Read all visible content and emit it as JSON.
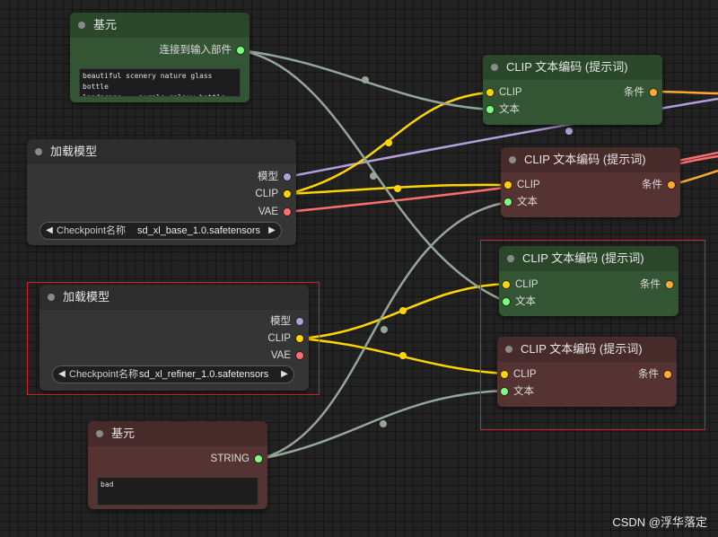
{
  "colors": {
    "background": "#222222",
    "clip_pin": "#ffd500",
    "model_pin": "#b39ddb",
    "vae_pin": "#ff6e6e",
    "conditioning_pin": "#ffa931",
    "string_pin": "#7dff80",
    "string_wire": "#94a698",
    "clip_wire": "#ffd500",
    "model_wire": "#b39ddb",
    "vae_wire": "#ff6e6e",
    "cond_wire": "#ffa931",
    "highlight_box": "#d02030"
  },
  "nodes": {
    "primitive_top": {
      "title": "基元",
      "output_label": "连接到输入部件",
      "text": "beautiful scenery nature glass bottle\nlandscape, , purple galaxy bottle,"
    },
    "load_model_base": {
      "title": "加载模型",
      "outputs": [
        "模型",
        "CLIP",
        "VAE"
      ],
      "combo_label": "Checkpoint名称",
      "combo_value": "sd_xl_base_1.0.safetensors",
      "arrow_left": "◀",
      "arrow_right": "▶"
    },
    "load_model_refiner": {
      "title": "加载模型",
      "outputs": [
        "模型",
        "CLIP",
        "VAE"
      ],
      "combo_label": "Checkpoint名称",
      "combo_value": "sd_xl_refiner_1.0.safetensors",
      "arrow_left": "◀",
      "arrow_right": "▶"
    },
    "primitive_bottom": {
      "title": "基元",
      "output_label": "STRING",
      "text": "bad"
    },
    "clip_encode_1": {
      "title": "CLIP 文本编码 (提示词)",
      "inputs": [
        "CLIP",
        "文本"
      ],
      "output": "条件"
    },
    "clip_encode_2": {
      "title": "CLIP 文本编码 (提示词)",
      "inputs": [
        "CLIP",
        "文本"
      ],
      "output": "条件"
    },
    "clip_encode_3": {
      "title": "CLIP 文本编码 (提示词)",
      "inputs": [
        "CLIP",
        "文本"
      ],
      "output": "条件"
    },
    "clip_encode_4": {
      "title": "CLIP 文本编码 (提示词)",
      "inputs": [
        "CLIP",
        "文本"
      ],
      "output": "条件"
    }
  },
  "watermark": "CSDN @浮华落定"
}
